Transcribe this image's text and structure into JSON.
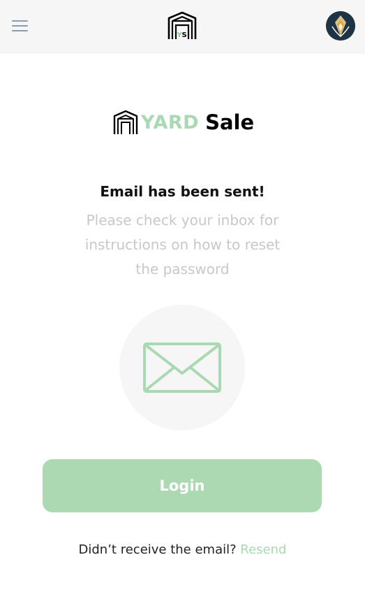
{
  "header": {
    "menu_icon": "hamburger-menu-icon",
    "logo_icon": "yard-sale-garage-icon",
    "logo_letters": "YS",
    "avatar_icon": "user-avatar"
  },
  "brand": {
    "word_yard": "YARD",
    "word_sale": "Sale",
    "accent_color": "#a9d9b2"
  },
  "content": {
    "title": "Email has been sent!",
    "message": "Please check your inbox for instructions on how to reset the password",
    "illustration_icon": "envelope-icon"
  },
  "actions": {
    "login_label": "Login",
    "resend_prompt": "Didn’t receive the email?",
    "resend_link": "Resend"
  }
}
